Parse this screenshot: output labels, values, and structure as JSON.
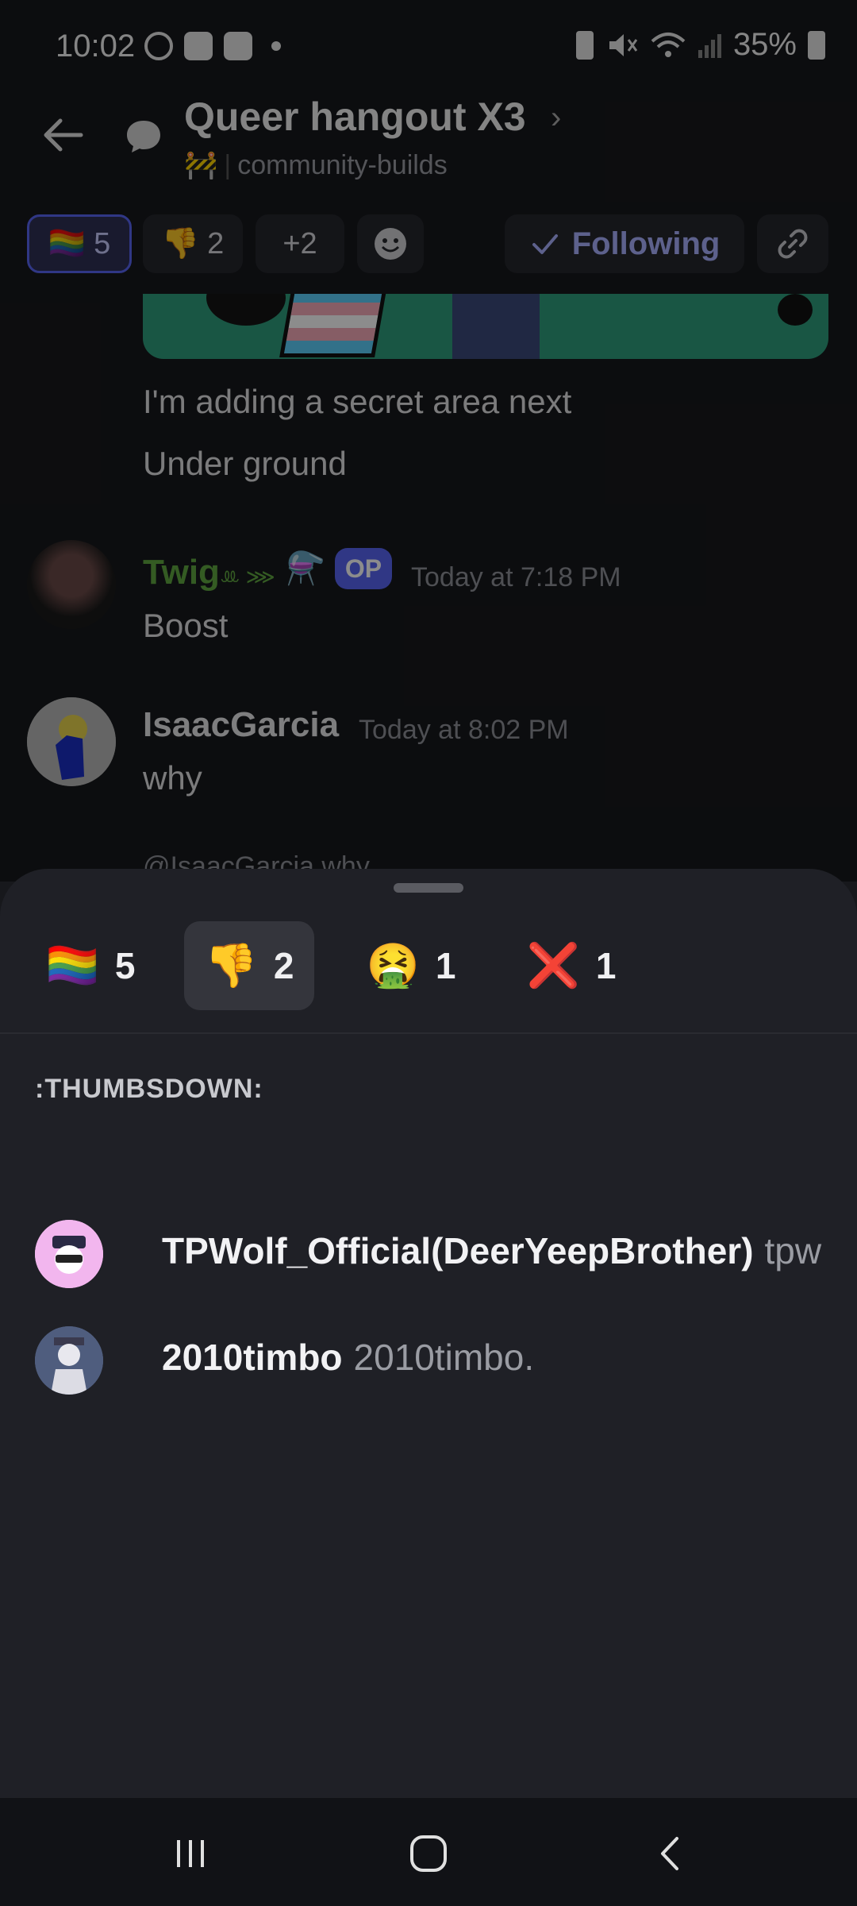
{
  "status_bar": {
    "time": "10:02",
    "battery": "35%"
  },
  "channel": {
    "title": "Queer hangout X3",
    "sub_emoji": "🚧",
    "sub_name": "community-builds"
  },
  "top_reactions": [
    {
      "emoji": "🏳️‍🌈",
      "count": "5",
      "active": true
    },
    {
      "emoji": "👎",
      "count": "2",
      "active": false
    },
    {
      "label": "+2"
    }
  ],
  "follow_label": "Following",
  "messages": {
    "line1": "I'm adding a secret area next",
    "line2": "Under ground",
    "m1": {
      "author": "Twig",
      "author_deco": "ꔛ ⋙",
      "badge_emoji": "⚗️",
      "badge": "OP",
      "timestamp": "Today at 7:18 PM",
      "text": "Boost",
      "name_color": "#5fa640"
    },
    "m2": {
      "author": "IsaacGarcia",
      "timestamp": "Today at 8:02 PM",
      "text": "why"
    },
    "reply_peek": "@IsaacGarcia why"
  },
  "sheet": {
    "tabs": [
      {
        "emoji": "🏳️‍🌈",
        "count": "5"
      },
      {
        "emoji": "👎",
        "count": "2"
      },
      {
        "emoji": "🤮",
        "count": "1"
      },
      {
        "emoji": "❌",
        "count": "1"
      }
    ],
    "selected_emoji_name": ":THUMBSDOWN:",
    "reactors": [
      {
        "name": "TPWolf_Official(DeerYeepBrother)",
        "handle": "tpw"
      },
      {
        "name": "2010timbo",
        "handle": "2010timbo."
      }
    ]
  },
  "colors": {
    "accent": "#5865f2",
    "sheet_bg": "#1f2026",
    "screen_bg": "#17181c"
  }
}
